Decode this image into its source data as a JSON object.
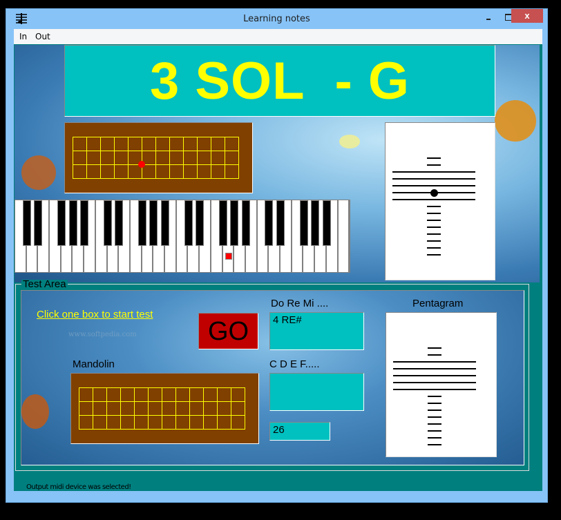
{
  "window": {
    "title": "Learning notes",
    "icon": "music-staff-icon",
    "controls": {
      "minimize": "minimize",
      "maximize": "maximize",
      "close": "x"
    }
  },
  "menu": {
    "items": [
      {
        "label": "In"
      },
      {
        "label": "Out"
      }
    ]
  },
  "current_note": {
    "text": "3 SOL  - G"
  },
  "mandolin_top": {
    "strings": 4,
    "frets": 12,
    "highlight": {
      "string": 3,
      "fret": 5
    }
  },
  "piano": {
    "white_keys": 29,
    "marked_white_key": 18
  },
  "staff_top": {
    "ledger_lines_above": 2,
    "staff_lines": 5,
    "ledger_lines_below": 8,
    "note_position": "4th staff line from top"
  },
  "test_area": {
    "legend": "Test Area",
    "start_link": "Click one box to start test",
    "go_button": "GO",
    "mandolin_label": "Mandolin",
    "doremi_label": "Do Re Mi ....",
    "doremi_value": "4 RE#",
    "cdef_label": "C D E F.....",
    "cdef_value": "",
    "score_value": "26",
    "pentagram_label": "Pentagram",
    "watermark": "www.softpedia.com"
  },
  "status": {
    "text": "Output midi device was selected!"
  },
  "colors": {
    "banner_bg": "#00c0c0",
    "banner_text": "#ffff00",
    "fretboard": "#804000",
    "fret_lines": "#ffff00",
    "go_button": "#c00000",
    "client_bg": "#007f7f",
    "marker": "#ff0000"
  }
}
